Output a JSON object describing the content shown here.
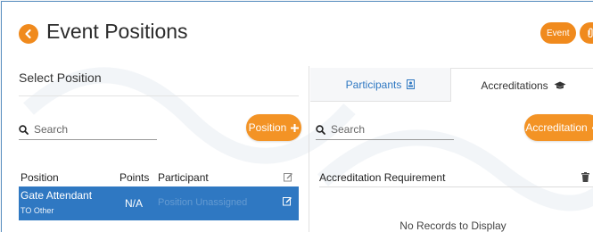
{
  "header": {
    "title": "Event Positions",
    "event_button_label": "Event"
  },
  "left_panel": {
    "section_title": "Select Position",
    "search_placeholder": "Search",
    "add_button_label": "Position",
    "columns": [
      "Position",
      "Points",
      "Participant"
    ],
    "rows": [
      {
        "position": "Gate Attendant",
        "sublabel": "TO Other",
        "points": "N/A",
        "participant": "Position Unassigned"
      }
    ]
  },
  "right_panel": {
    "tabs": [
      {
        "label": "Participants",
        "active": false
      },
      {
        "label": "Accreditations",
        "active": true
      }
    ],
    "search_placeholder": "Search",
    "add_button_label": "Accreditation",
    "columns": [
      "Accreditation Requirement"
    ],
    "empty_message": "No Records to Display"
  },
  "colors": {
    "accent": "#f39325",
    "selected_row": "#2f78c2",
    "active_tab_text": "#2f78c2"
  }
}
